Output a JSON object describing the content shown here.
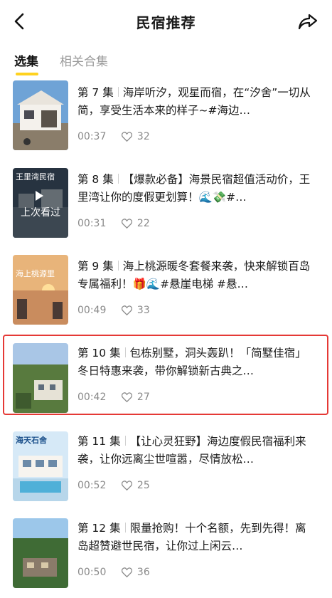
{
  "header": {
    "title": "民宿推荐"
  },
  "tabs": {
    "active": "选集",
    "inactive": "相关合集"
  },
  "items": [
    {
      "ep": "第 7 集",
      "text": "海岸听汐，观星而宿，在“汐舍”一切从简，享受生活本来的样子~#海边…",
      "duration": "00:37",
      "likes": "32"
    },
    {
      "ep": "第 8 集",
      "text": "【爆款必备】海景民宿超值活动价，王里湾让你的度假更划算！🌊💸#…",
      "duration": "00:31",
      "likes": "22",
      "thumb_title": "王里湾民宿",
      "overlay": "上次看过"
    },
    {
      "ep": "第 9 集",
      "text": "海上桃源暖冬套餐来袭，快来解锁百岛专属福利！🎁🌊#悬崖电梯 #悬…",
      "duration": "00:49",
      "likes": "33",
      "thumb_title": "海上桃源里"
    },
    {
      "ep": "第 10 集",
      "text": "包栋别墅，洞头轰趴！「简墅佳宿」冬日特惠来袭，带你解锁新古典之…",
      "duration": "00:42",
      "likes": "27"
    },
    {
      "ep": "第 11 集",
      "text": "【让心灵狂野】海边度假民宿福利来袭，让你远离尘世喧嚣，尽情放松…",
      "duration": "00:52",
      "likes": "25",
      "thumb_title": "海天石舍"
    },
    {
      "ep": "第 12 集",
      "text": "限量抢购！十个名额，先到先得！离岛超赞避世民宿，让你过上闲云…",
      "duration": "00:50",
      "likes": "36"
    }
  ],
  "colors": {
    "accent": "#ffd21f",
    "highlight": "#e53935"
  }
}
